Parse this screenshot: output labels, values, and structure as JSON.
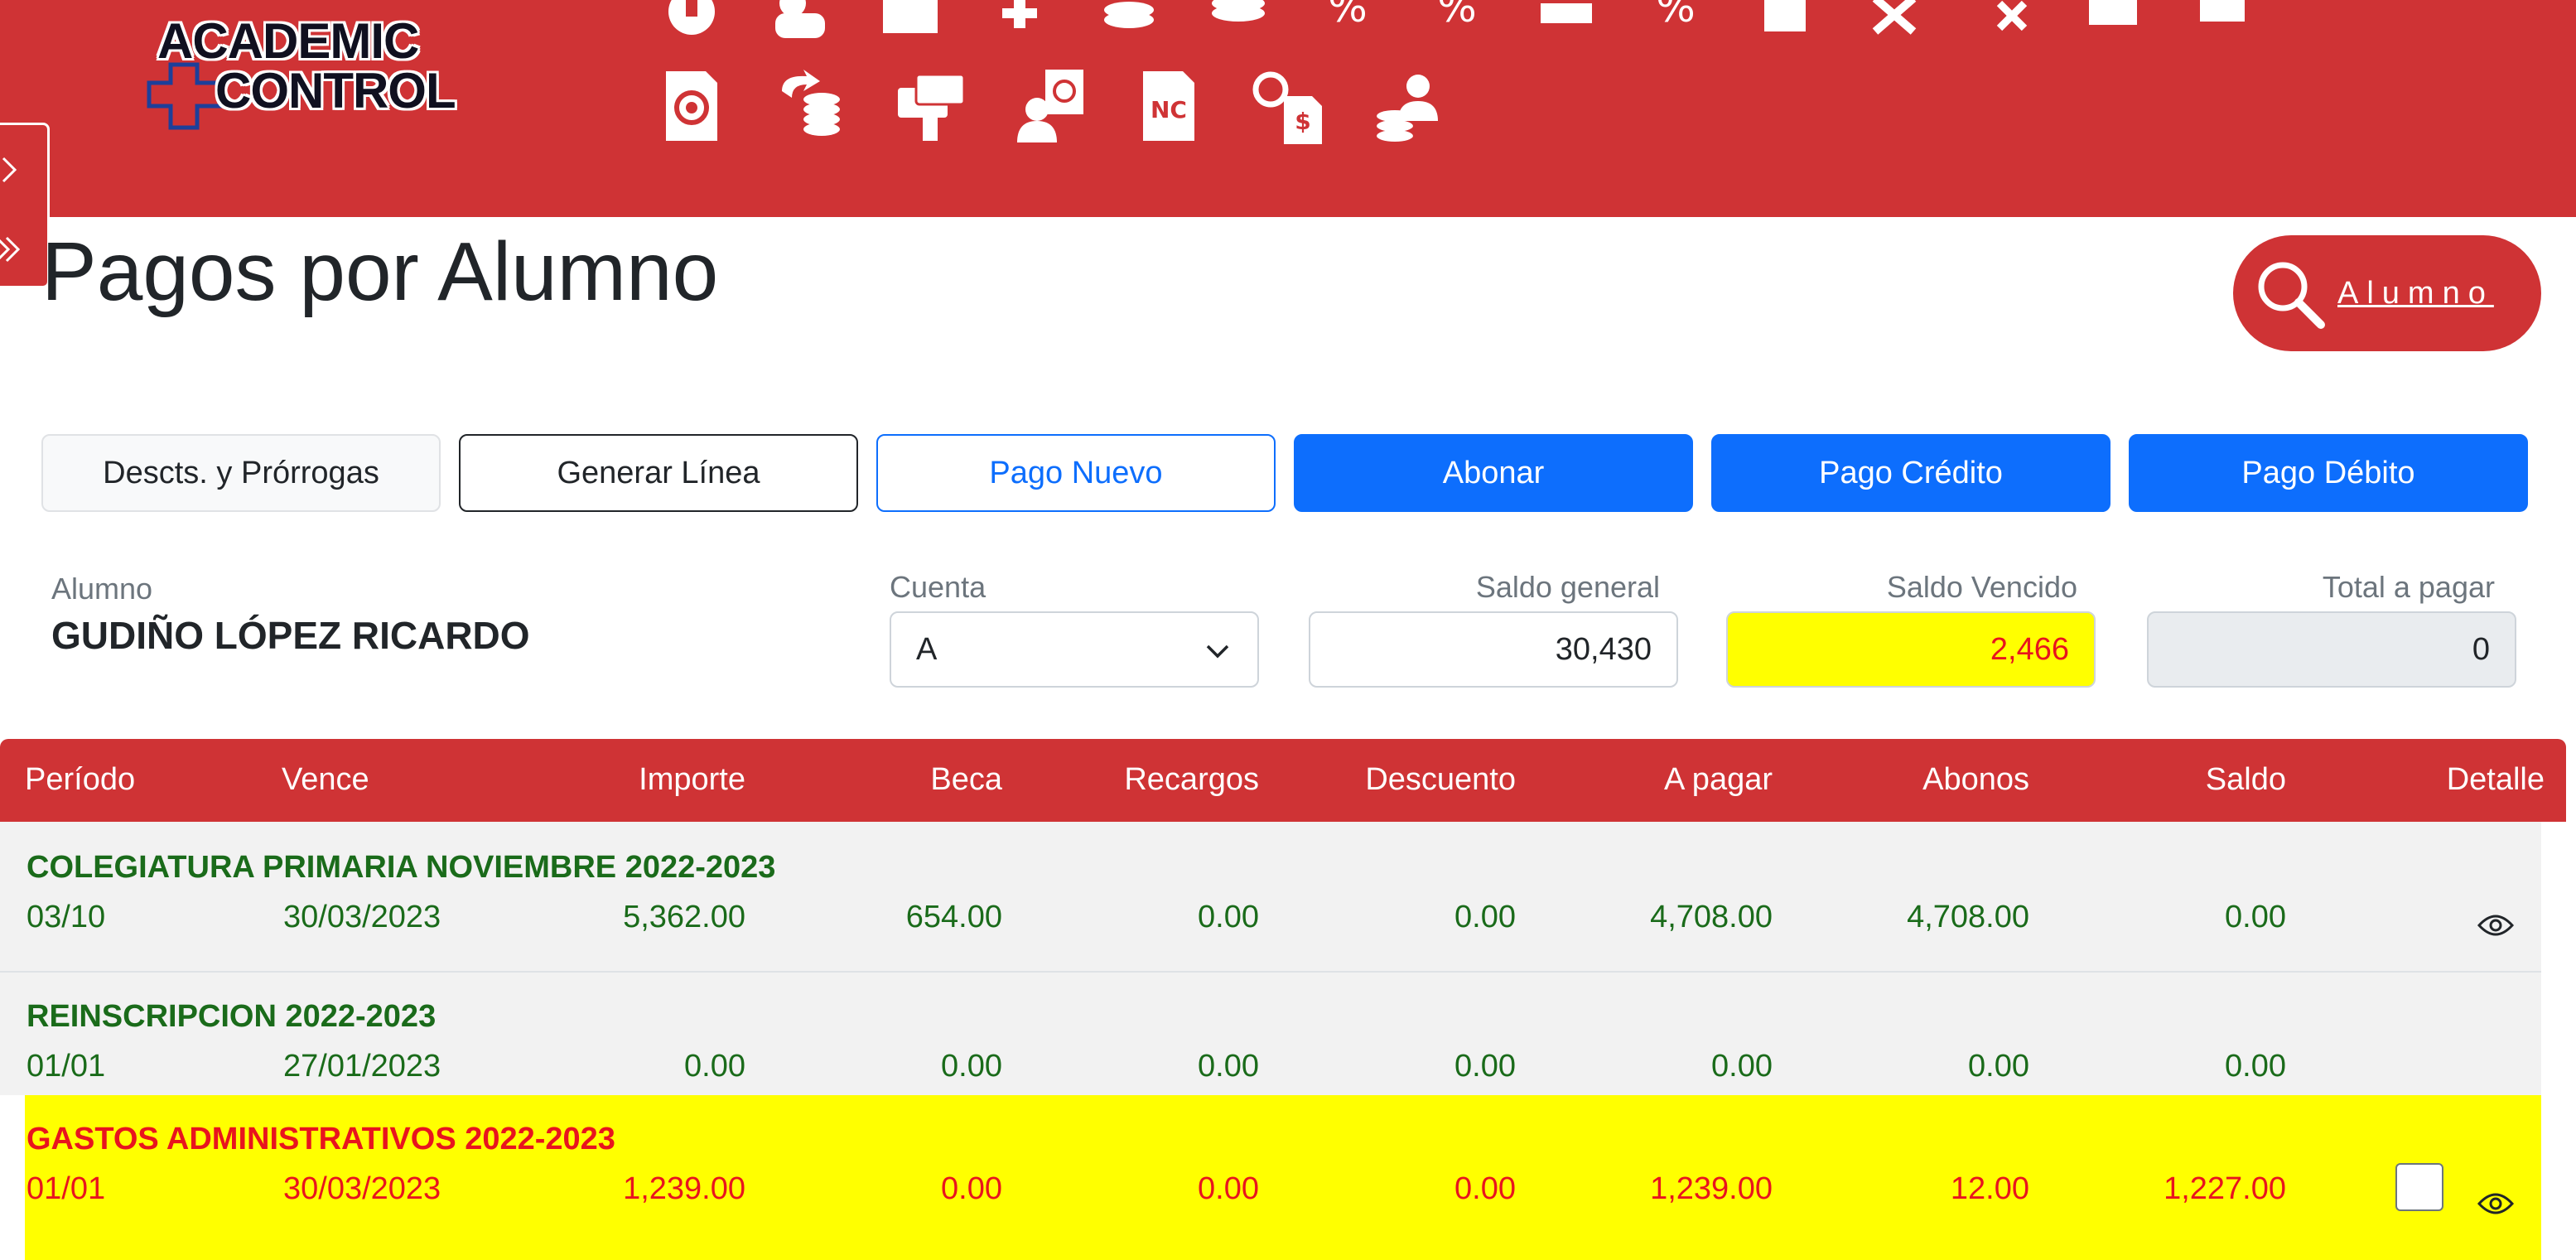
{
  "header": {
    "logo_line1": "ACADEMIC",
    "logo_line2": "CONTROL",
    "top_icons": [
      "book-icon",
      "users-icon",
      "folder-icon",
      "pin-icon",
      "coins-icon",
      "coins-stack-icon",
      "percent-icon",
      "percent-doc-icon",
      "cash-icon",
      "percent-cash-icon",
      "docs-icon",
      "cancel-icon",
      "remove-person-icon",
      "printer-icon",
      "export-icon"
    ],
    "bottom_icons": [
      "email-doc-icon",
      "refund-coins-icon",
      "card-payment-icon",
      "email-user-icon",
      "nc-doc-icon",
      "email-invoice-icon",
      "user-coins-icon"
    ]
  },
  "page": {
    "title": "Pagos por Alumno",
    "search_label": "Alumno"
  },
  "toolbar": {
    "descuentos": "Descts. y Prórrogas",
    "generar_linea": "Generar Línea",
    "pago_nuevo": "Pago Nuevo",
    "abonar": "Abonar",
    "pago_credito": "Pago Crédito",
    "pago_debito": "Pago Débito"
  },
  "info": {
    "alumno_label": "Alumno",
    "alumno_name": "GUDIÑO LÓPEZ RICARDO",
    "cuenta_label": "Cuenta",
    "cuenta_value": "A",
    "saldo_general_label": "Saldo general",
    "saldo_general_value": "30,430",
    "saldo_vencido_label": "Saldo Vencido",
    "saldo_vencido_value": "2,466",
    "total_label": "Total a pagar",
    "total_value": "0"
  },
  "table": {
    "columns": [
      "Período",
      "Vence",
      "Importe",
      "Beca",
      "Recargos",
      "Descuento",
      "A pagar",
      "Abonos",
      "Saldo",
      "Detalle"
    ],
    "rows": [
      {
        "title": "COLEGIATURA PRIMARIA NOVIEMBRE 2022-2023",
        "periodo": "03/10",
        "vence": "30/03/2023",
        "importe": "5,362.00",
        "beca": "654.00",
        "recargos": "0.00",
        "descuento": "0.00",
        "a_pagar": "4,708.00",
        "abonos": "4,708.00",
        "saldo": "0.00"
      },
      {
        "title": "REINSCRIPCION 2022-2023",
        "periodo": "01/01",
        "vence": "27/01/2023",
        "importe": "0.00",
        "beca": "0.00",
        "recargos": "0.00",
        "descuento": "0.00",
        "a_pagar": "0.00",
        "abonos": "0.00",
        "saldo": "0.00"
      },
      {
        "title": "GASTOS ADMINISTRATIVOS 2022-2023",
        "periodo": "01/01",
        "vence": "30/03/2023",
        "importe": "1,239.00",
        "beca": "0.00",
        "recargos": "0.00",
        "descuento": "0.00",
        "a_pagar": "1,239.00",
        "abonos": "12.00",
        "saldo": "1,227.00"
      }
    ]
  },
  "colors": {
    "brand_red": "#cf3335",
    "primary_blue": "#0d6efd",
    "paid_green": "#1a6b1a",
    "overdue_red": "#e8141e",
    "overdue_highlight": "#ffff00"
  }
}
